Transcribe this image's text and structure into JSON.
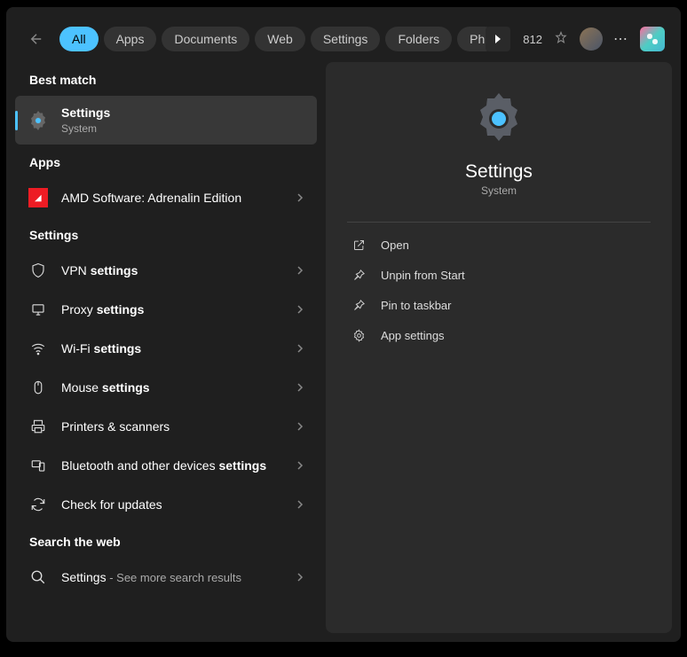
{
  "header": {
    "tabs": [
      "All",
      "Apps",
      "Documents",
      "Web",
      "Settings",
      "Folders",
      "Ph"
    ],
    "activeTab": 0,
    "points": "812"
  },
  "left": {
    "sections": {
      "bestMatch": "Best match",
      "apps": "Apps",
      "settings": "Settings",
      "searchWeb": "Search the web"
    },
    "bestMatchItem": {
      "title": "Settings",
      "subtitle": "System"
    },
    "appsItems": [
      {
        "text": "AMD Software: Adrenalin Edition"
      }
    ],
    "settingsItems": [
      {
        "prefix": "VPN ",
        "bold": "settings"
      },
      {
        "prefix": "Proxy ",
        "bold": "settings"
      },
      {
        "prefix": "Wi-Fi ",
        "bold": "settings"
      },
      {
        "prefix": "Mouse ",
        "bold": "settings"
      },
      {
        "prefix": "Printers & scanners",
        "bold": ""
      },
      {
        "prefix": "Bluetooth and other devices ",
        "bold": "settings"
      },
      {
        "prefix": "Check for updates",
        "bold": ""
      }
    ],
    "webItem": {
      "prefix": "Settings",
      "suffix": " - See more search results"
    }
  },
  "right": {
    "title": "Settings",
    "subtitle": "System",
    "actions": [
      {
        "label": "Open"
      },
      {
        "label": "Unpin from Start"
      },
      {
        "label": "Pin to taskbar"
      },
      {
        "label": "App settings"
      }
    ]
  }
}
